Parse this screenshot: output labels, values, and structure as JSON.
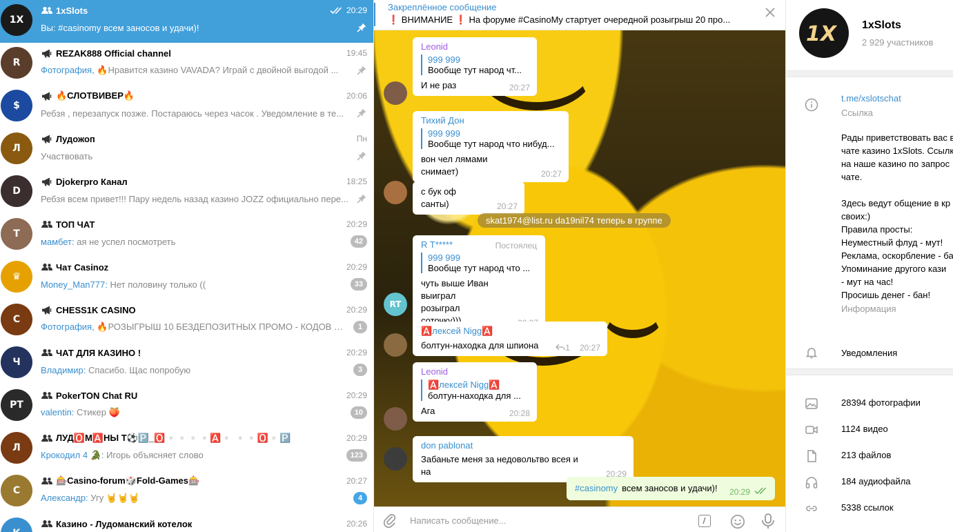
{
  "chats": [
    {
      "name": "1xSlots",
      "kind": "group",
      "time": "20:29",
      "sender": "",
      "preview": "Вы: #casinomy  всем заносов и удачи)!",
      "badge": "",
      "pinned": true,
      "active": true,
      "read_ticks": true,
      "avatar_text": "1X",
      "avatar_color": "#1a1a1a"
    },
    {
      "name": "REZAK888 Official channel",
      "kind": "channel",
      "time": "19:45",
      "sender": "Фотография, ",
      "preview": "🔥Нравится казино VAVADA? Играй с двойной выгодой ...",
      "badge": "",
      "pinned": true,
      "avatar_text": "R",
      "avatar_color": "#5a3e2b"
    },
    {
      "name": "🔥СЛОТВИВЕР🔥",
      "kind": "channel",
      "time": "20:06",
      "sender": "",
      "preview": "Ребзя , перезапуск позже. Постараюсь через часок . Уведомление в те...",
      "badge": "",
      "pinned": true,
      "avatar_text": "$",
      "avatar_color": "#1b4aa0"
    },
    {
      "name": "Лудожоп",
      "kind": "channel",
      "time": "Пн",
      "sender": "",
      "preview": "Участвовать",
      "badge": "",
      "pinned": true,
      "avatar_text": "Л",
      "avatar_color": "#8a5a10"
    },
    {
      "name": "Djokerpro Канал",
      "kind": "channel",
      "time": "18:25",
      "sender": "",
      "preview": "Ребзя всем привет!!! Пару недель назад казино JOZZ официально пере...",
      "badge": "",
      "pinned": true,
      "avatar_text": "D",
      "avatar_color": "#3b2e2e"
    },
    {
      "name": "ТОП ЧАТ",
      "kind": "group",
      "time": "20:29",
      "sender": "мамбет: ",
      "preview": "ая не успел посмотреть",
      "badge": "42",
      "badge_blue": false,
      "avatar_text": "Т",
      "avatar_color": "#8d6b55"
    },
    {
      "name": "Чат Casinoz",
      "kind": "group",
      "time": "20:29",
      "sender": "Money_Man777: ",
      "preview": "Нет половину только ((",
      "badge": "33",
      "badge_blue": false,
      "avatar_text": "♛",
      "avatar_color": "#e6a100"
    },
    {
      "name": "CHESS1K CASINO",
      "kind": "channel",
      "time": "20:29",
      "sender": "Фотография, ",
      "preview": "🔥РОЗЫГРЫШ 10  БЕЗДЕПОЗИТНЫХ ПРОМО - КОДОВ В ...",
      "badge": "1",
      "badge_blue": false,
      "avatar_text": "C",
      "avatar_color": "#7a3b12"
    },
    {
      "name": "ЧАТ ДЛЯ КАЗИНО !",
      "kind": "group",
      "time": "20:29",
      "sender": "Владимир: ",
      "preview": "Спасибо. Щас попробую",
      "badge": "3",
      "badge_blue": false,
      "avatar_text": "Ч",
      "avatar_color": "#23335e"
    },
    {
      "name": "PokerTON Chat RU",
      "kind": "group",
      "time": "20:29",
      "sender": "valentin: ",
      "preview": "Стикер 🍑",
      "badge": "10",
      "badge_blue": false,
      "avatar_text": "PT",
      "avatar_color": "#2a2a2a"
    },
    {
      "name": "ЛУД🅾️М🅰️НЫ Т⚽️🅿️_🅾️▫️▫️▫️▫️🅰️▫️ ▫️▫️🅾️▫️🅿️",
      "kind": "group",
      "time": "20:29",
      "sender": "Крокодил 4 🐊: ",
      "preview": "Игорь объясняет слово",
      "badge": "123",
      "badge_blue": false,
      "avatar_text": "Л",
      "avatar_color": "#7a3a12"
    },
    {
      "name": "🎰Casino-forum🎲Fold-Games🎰",
      "kind": "group",
      "time": "20:27",
      "sender": "Александр: ",
      "preview": "Угу 🤘🤘🤘",
      "badge": "4",
      "badge_blue": true,
      "avatar_text": "C",
      "avatar_color": "#9a7a30"
    },
    {
      "name": "Казино - Лудоманский котелок",
      "kind": "group",
      "time": "20:26",
      "sender": "",
      "preview": "",
      "badge": "",
      "avatar_text": "К",
      "avatar_color": "#3a8fcf"
    }
  ],
  "pinned": {
    "title": "Закреплённое сообщение",
    "text": "❗️ ВНИМАНИЕ ❗️  На форуме #CasinoMy стартует очередной розыгрыш 20 про..."
  },
  "messages": [
    {
      "author": "Leonid",
      "author_color": "#a05ee0",
      "reply_name": "999 999",
      "reply_text": "Вообще тут народ чт...",
      "text": "И не раз",
      "time": "20:27"
    },
    {
      "author": "Тихий Дон",
      "author_color": "#3a8fcf",
      "reply_name": "999 999",
      "reply_text": "Вообще тут народ что нибуд...",
      "text": "вон чел лямами снимает)",
      "time": "20:27"
    },
    {
      "text": "с бук оф санты)",
      "time": "20:27"
    },
    {
      "service": "skat1974@list.ru da19nil74 теперь в группе"
    },
    {
      "author": "R T*****",
      "author_color": "#3a8fcf",
      "role": "Постоялец",
      "reply_name": "999 999",
      "reply_text": "Вообще тут народ что ...",
      "text": "чуть выше Иван выиграл\nрозыграл соточку)))",
      "time": "20:27",
      "avatar_initials": "RT"
    },
    {
      "author": "🅰️лексей Nigg🅰️",
      "author_color": "#3a8fcf",
      "text": "болтун-находка для шпиона",
      "replies": "1",
      "time": "20:27"
    },
    {
      "author": "Leonid",
      "author_color": "#a05ee0",
      "reply_name": "🅰️лексей Nigg🅰️",
      "reply_text": "болтун-находка для ...",
      "text": "Ага",
      "time": "20:28"
    },
    {
      "author": "don pablonat",
      "author_color": "#3a8fcf",
      "text": "Забаньте меня за недовольтво всея и на",
      "time": "20:29"
    },
    {
      "hashtag": "#casinomy",
      "text": "всем заносов и удачи)!",
      "time": "20:29"
    }
  ],
  "compose": {
    "placeholder": "Написать сообщение..."
  },
  "info": {
    "name": "1xSlots",
    "members": "2 929 участников",
    "link": "t.me/xslotschat",
    "link_label": "Ссылка",
    "description_lines": [
      "Рады приветствовать вас в",
      "чате казино 1xSlots. Ссылк",
      "на наше казино по запрос",
      "чате.",
      "",
      "Здесь ведут общение в кр",
      "своих:)",
      "Правила просты:",
      "Неуместный флуд - мут!",
      "Реклама, оскорбление - ба",
      "Упоминание другого кази",
      "- мут на час!",
      "Просишь денег - бан!"
    ],
    "description_label": "Информация",
    "notifications": "Уведомления",
    "media": [
      {
        "label": "28394 фотографии",
        "icon": "photo-icon"
      },
      {
        "label": "1124 видео",
        "icon": "video-icon"
      },
      {
        "label": "213 файлов",
        "icon": "file-icon"
      },
      {
        "label": "184 аудиофайла",
        "icon": "headphones-icon"
      },
      {
        "label": "5338 ссылок",
        "icon": "link-icon"
      }
    ]
  },
  "colors": {
    "accent": "#419fd9",
    "link": "#3a8fcf",
    "bubble_out": "#effdde"
  }
}
